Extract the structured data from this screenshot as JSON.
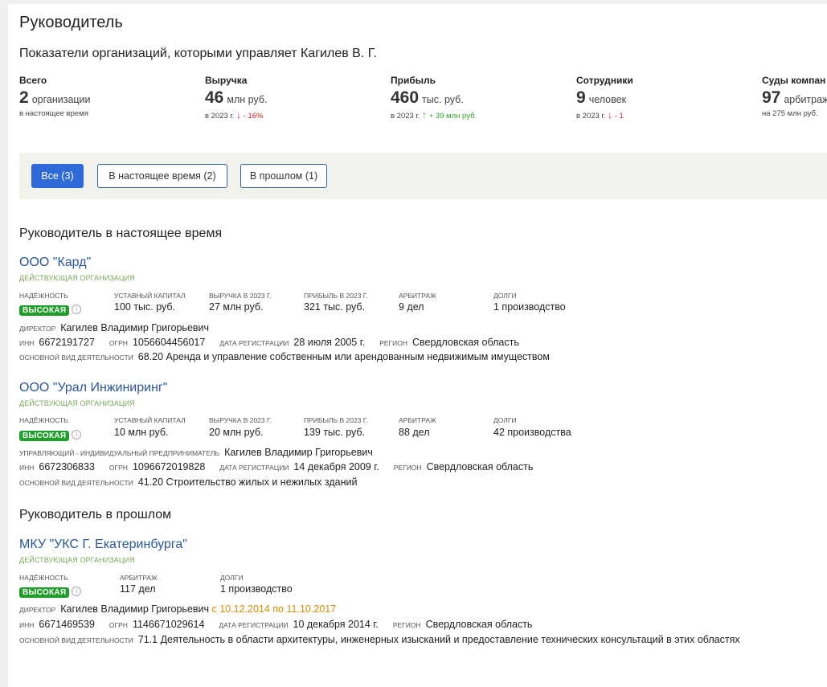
{
  "page": {
    "title": "Руководитель",
    "subtitle": "Показатели организаций, которыми управляет Кагилев В. Г."
  },
  "stats": [
    {
      "label": "Всего",
      "value": "2",
      "unit": "организации",
      "sub": "в настоящее время",
      "change": "",
      "direction": "none"
    },
    {
      "label": "Выручка",
      "value": "46",
      "unit": "млн руб.",
      "sub": "в 2023 г.",
      "change": "- 16%",
      "direction": "down"
    },
    {
      "label": "Прибыль",
      "value": "460",
      "unit": "тыс. руб.",
      "sub": "в 2023 г.",
      "change": "+ 39 млн руб.",
      "direction": "up"
    },
    {
      "label": "Сотрудники",
      "value": "9",
      "unit": "человек",
      "sub": "в 2023 г.",
      "change": "- 1",
      "direction": "down"
    },
    {
      "label": "Суды компан",
      "value": "97",
      "unit": "арбитраж",
      "sub": "на 275 млн руб.",
      "change": "",
      "direction": "none"
    }
  ],
  "filters": [
    {
      "label": "Все (3)",
      "active": true
    },
    {
      "label": "В настоящее время (2)",
      "active": false
    },
    {
      "label": "В прошлом (1)",
      "active": false
    }
  ],
  "sections": {
    "current": "Руководитель в настоящее время",
    "past": "Руководитель в прошлом"
  },
  "labels": {
    "reliability": "надёжность",
    "capital": "уставный капитал",
    "revenue": "выручка в 2023 г.",
    "profit": "прибыль в 2023 г.",
    "arbitration": "арбитраж",
    "debts": "долги",
    "director": "директор",
    "manager_ip": "управляющий - индивидуальный предприниматель",
    "inn": "ИНН",
    "ogrn": "ОГРН",
    "reg_date": "дата регистрации",
    "region": "регион",
    "activity": "основной вид деятельности",
    "high": "ВЫСОКАЯ",
    "info_glyph": "i"
  },
  "orgs": [
    {
      "name": "ООО \"Кард\"",
      "status": "ДЕЙСТВУЮЩАЯ ОРГАНИЗАЦИЯ",
      "capital": "100 тыс. руб.",
      "revenue": "27 млн руб.",
      "profit": "321 тыс. руб.",
      "arbitration": "9 дел",
      "debts": "1 производство",
      "person": "Кагилев Владимир Григорьевич",
      "inn": "6672191727",
      "ogrn": "1056604456017",
      "reg_date": "28 июля 2005 г.",
      "region": "Свердловская область",
      "activity": "68.20 Аренда и управление собственным или арендованным недвижимым имуществом"
    },
    {
      "name": "ООО \"Урал Инжиниринг\"",
      "status": "ДЕЙСТВУЮЩАЯ ОРГАНИЗАЦИЯ",
      "capital": "10 млн руб.",
      "revenue": "20 млн руб.",
      "profit": "139 тыс. руб.",
      "arbitration": "88 дел",
      "debts": "42 производства",
      "person": "Кагилев Владимир Григорьевич",
      "inn": "6672306833",
      "ogrn": "1096672019828",
      "reg_date": "14 декабря 2009 г.",
      "region": "Свердловская область",
      "activity": "41.20 Строительство жилых и нежилых зданий"
    },
    {
      "name": "МКУ \"УКС Г. Екатеринбурга\"",
      "status": "ДЕЙСТВУЮЩАЯ ОРГАНИЗАЦИЯ",
      "arbitration": "117 дел",
      "debts": "1 производство",
      "person": "Кагилев Владимир Григорьевич",
      "period": "с 10.12.2014 по 11.10.2017",
      "inn": "6671469539",
      "ogrn": "1146671029614",
      "reg_date": "10 декабря 2014 г.",
      "region": "Свердловская область",
      "activity": "71.1 Деятельность в области архитектуры, инженерных изысканий и предоставление технических консультаций в этих областях"
    }
  ],
  "colors": {
    "link": "#2a56a0",
    "active_status": "#7aa85a",
    "badge_green": "#1f9f2a",
    "down_red": "#d21b1b",
    "up_green": "#2ea527",
    "period_orange": "#e08a00",
    "primary_button": "#2f6bd8"
  }
}
